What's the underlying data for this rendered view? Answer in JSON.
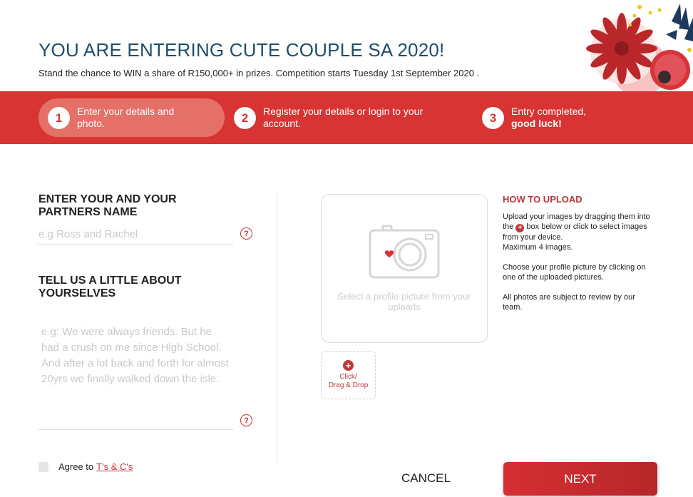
{
  "header": {
    "title": "YOU ARE ENTERING CUTE COUPLE SA 2020!",
    "subtitle": "Stand the chance to WIN a share of R150,000+ in prizes. Competition starts Tuesday 1st September 2020 ."
  },
  "steps": [
    {
      "number": "1",
      "line1": "Enter your details and",
      "line2": "photo.",
      "active": true
    },
    {
      "number": "2",
      "line1": "Register your details or login to your",
      "line2": "account.",
      "active": false
    },
    {
      "number": "3",
      "line1": "Entry completed,",
      "line2": "good luck!",
      "active": false
    }
  ],
  "form": {
    "names_label": "ENTER YOUR AND YOUR PARTNERS NAME",
    "names_placeholder": "e.g Ross and Rachel",
    "names_value": "",
    "about_label": "TELL US A LITTLE ABOUT YOURSELVES",
    "about_placeholder": "e.g: We were always friends. But he had a crush on me since High School. And after a lot back and forth for almost 20yrs we finally walked down the isle.",
    "about_value": "",
    "help_glyph": "?",
    "agree_label": "Agree to",
    "agree_link": "T's & C's"
  },
  "upload": {
    "preview_text": "Select a profile picture from your uploads",
    "dropzone_line1": "Click/",
    "dropzone_line2": "Drag & Drop",
    "plus_glyph": "+",
    "how_title": "HOW TO UPLOAD",
    "how_p1_a": "Upload your images by dragging them into the",
    "how_p1_b": "box below or click to select images from your device.",
    "how_p1_c": "Maximum 4 images.",
    "how_p2": "Choose your profile picture by clicking on one of the uploaded pictures.",
    "how_p3": "All photos are subject to review by our team."
  },
  "buttons": {
    "cancel": "CANCEL",
    "next": "NEXT"
  },
  "colors": {
    "brand_red": "#d93434",
    "accent_red": "#c0393b",
    "title_blue": "#1f4e6b",
    "active_step_bg": "#e57068"
  }
}
